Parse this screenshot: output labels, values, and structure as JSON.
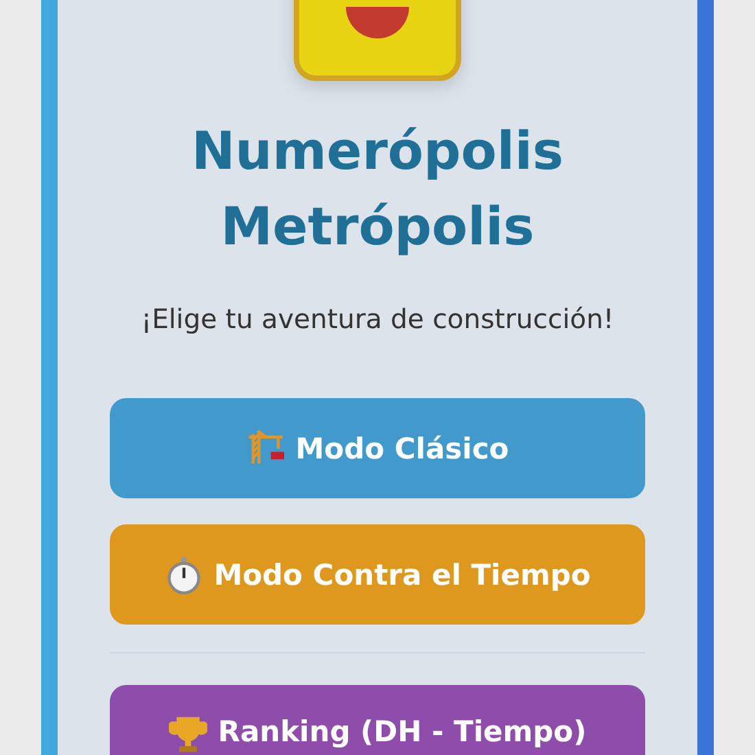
{
  "title_lines": [
    "Numerópolis",
    "Metrópolis"
  ],
  "subtitle": "¡Elige tu aventura de construcción!",
  "buttons": [
    {
      "label": "Modo Clásico",
      "kind": "classic",
      "color": "#4299cc"
    },
    {
      "label": "Modo Contra el Tiempo",
      "kind": "timed",
      "color": "#de981e"
    },
    {
      "kind": "divider"
    },
    {
      "label": "Ranking (DH - Tiempo)",
      "kind": "ranking",
      "color": "#8e4dab"
    }
  ]
}
